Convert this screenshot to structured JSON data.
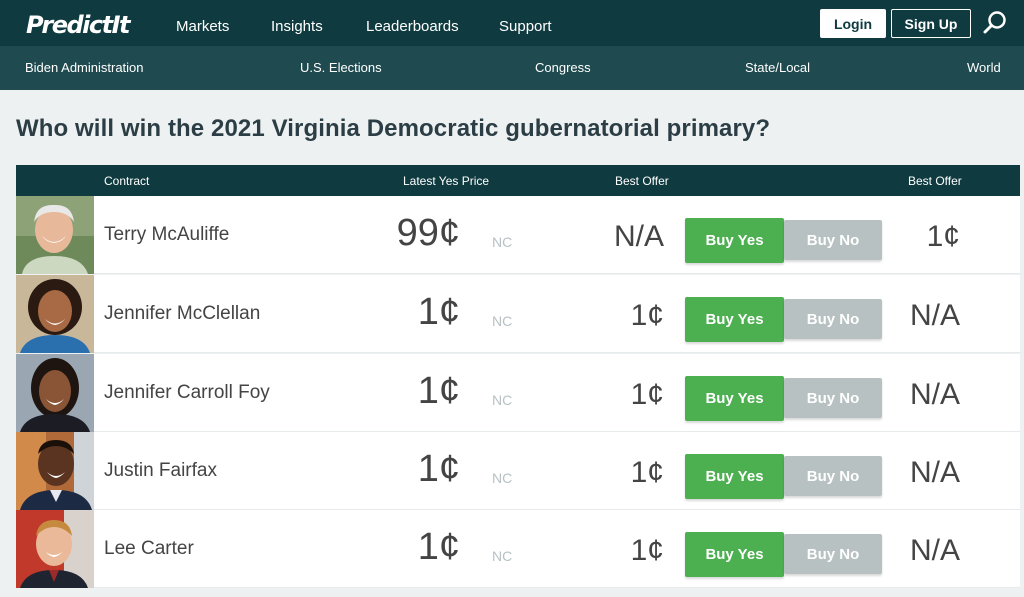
{
  "header": {
    "logo": "PredictIt",
    "nav": [
      "Markets",
      "Insights",
      "Leaderboards",
      "Support"
    ],
    "login": "Login",
    "signup": "Sign Up"
  },
  "categories": [
    "Biden Administration",
    "U.S. Elections",
    "Congress",
    "State/Local",
    "World"
  ],
  "market": {
    "title": "Who will win the 2021 Virginia Democratic gubernatorial primary?"
  },
  "table": {
    "headers": {
      "contract": "Contract",
      "latest_yes": "Latest Yes Price",
      "best_offer_yes": "Best Offer",
      "best_offer_no": "Best Offer"
    },
    "buy_yes": "Buy Yes",
    "buy_no": "Buy No",
    "rows": [
      {
        "name": "Terry McAuliffe",
        "price": "99¢",
        "change": "NC",
        "best_yes": "N/A",
        "best_no": "1¢"
      },
      {
        "name": "Jennifer McClellan",
        "price": "1¢",
        "change": "NC",
        "best_yes": "1¢",
        "best_no": "N/A"
      },
      {
        "name": "Jennifer Carroll Foy",
        "price": "1¢",
        "change": "NC",
        "best_yes": "1¢",
        "best_no": "N/A"
      },
      {
        "name": "Justin Fairfax",
        "price": "1¢",
        "change": "NC",
        "best_yes": "1¢",
        "best_no": "N/A"
      },
      {
        "name": "Lee Carter",
        "price": "1¢",
        "change": "NC",
        "best_yes": "1¢",
        "best_no": "N/A"
      }
    ]
  },
  "colors": {
    "nav_dark": "#0f3a3f",
    "nav_secondary": "#1f4b50",
    "buy_yes": "#4caf50",
    "buy_no": "#b7c1c1"
  }
}
